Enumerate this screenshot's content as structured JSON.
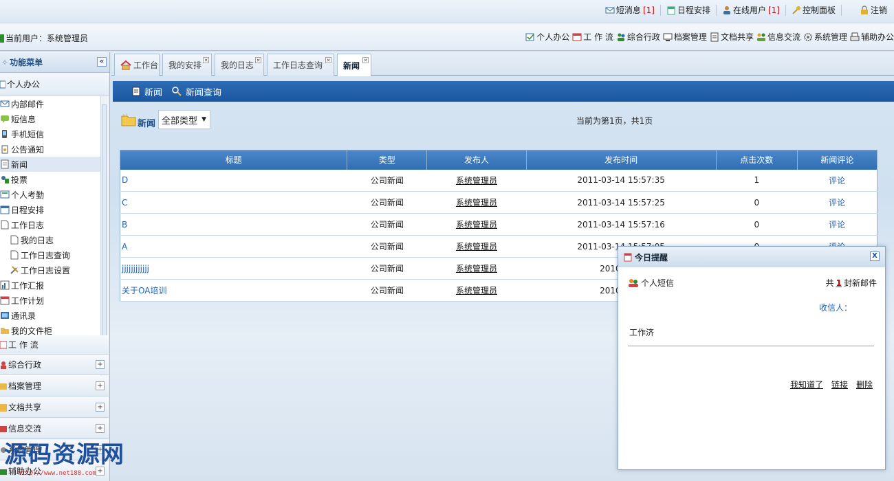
{
  "topbar": {
    "links": [
      {
        "label": "短消息",
        "badge": "[1]",
        "icon": "envelope-icon"
      },
      {
        "label": "日程安排",
        "icon": "calendar-icon"
      },
      {
        "label": "在线用户",
        "badge": "[1]",
        "icon": "user-icon"
      },
      {
        "label": "控制面板",
        "icon": "key-icon"
      },
      {
        "label": "注销",
        "icon": "lock-icon"
      }
    ]
  },
  "userbar": {
    "current_user": "当前用户：系统管理员",
    "modules": [
      "个人办公",
      "工 作 流",
      "综合行政",
      "档案管理",
      "文档共享",
      "信息交流",
      "系统管理",
      "辅助办公"
    ]
  },
  "sidebar": {
    "title": "功能菜单",
    "collapse": "«",
    "open_group": "个人办公",
    "items": [
      {
        "label": "内部邮件",
        "sub": false
      },
      {
        "label": "短信息",
        "sub": false
      },
      {
        "label": "手机短信",
        "sub": false
      },
      {
        "label": "公告通知",
        "sub": false
      },
      {
        "label": "新闻",
        "sub": false,
        "active": true
      },
      {
        "label": "投票",
        "sub": false
      },
      {
        "label": "个人考勤",
        "sub": false
      },
      {
        "label": "日程安排",
        "sub": false
      },
      {
        "label": "工作日志",
        "sub": false
      },
      {
        "label": "我的日志",
        "sub": true
      },
      {
        "label": "工作日志查询",
        "sub": true
      },
      {
        "label": "工作日志设置",
        "sub": true
      },
      {
        "label": "工作汇报",
        "sub": false
      },
      {
        "label": "工作计划",
        "sub": false
      },
      {
        "label": "通讯录",
        "sub": false
      },
      {
        "label": "我的文件柜",
        "sub": false
      }
    ],
    "groups": [
      "工 作 流",
      "综合行政",
      "档案管理",
      "文档共享",
      "信息交流",
      "系统管理",
      "辅助办公"
    ],
    "plus": "+"
  },
  "tabs": [
    {
      "label": "工作台",
      "closable": false
    },
    {
      "label": "我的安排",
      "closable": true
    },
    {
      "label": "我的日志",
      "closable": true
    },
    {
      "label": "工作日志查询",
      "closable": true
    },
    {
      "label": "新闻",
      "closable": true,
      "active": true
    }
  ],
  "toolbar": {
    "news_label": "新闻",
    "query_label": "新闻查询"
  },
  "filter": {
    "title": "新闻",
    "select_value": "全部类型",
    "page_info": "当前为第1页，共1页"
  },
  "table": {
    "headers": [
      "标题",
      "类型",
      "发布人",
      "发布时间",
      "点击次数",
      "新闻评论"
    ],
    "rows": [
      {
        "title": "D",
        "type": "公司新闻",
        "publisher": "系统管理员",
        "time": "2011-03-14 15:57:35",
        "clicks": "1",
        "comment": "评论"
      },
      {
        "title": "C",
        "type": "公司新闻",
        "publisher": "系统管理员",
        "time": "2011-03-14 15:57:25",
        "clicks": "0",
        "comment": "评论"
      },
      {
        "title": "B",
        "type": "公司新闻",
        "publisher": "系统管理员",
        "time": "2011-03-14 15:57:16",
        "clicks": "0",
        "comment": "评论"
      },
      {
        "title": "A",
        "type": "公司新闻",
        "publisher": "系统管理员",
        "time": "2011-03-14 15:57:05",
        "clicks": "0",
        "comment": "评论"
      },
      {
        "title": "jjjjjjjjjjjj",
        "type": "公司新闻",
        "publisher": "系统管理员",
        "time": "2010-02-0",
        "clicks": "",
        "comment": ""
      },
      {
        "title": "关于OA培训",
        "type": "公司新闻",
        "publisher": "系统管理员",
        "time": "2010-02-0",
        "clicks": "",
        "comment": ""
      }
    ]
  },
  "popup": {
    "title": "今日提醒",
    "close": "X",
    "category": "个人短信",
    "count_prefix": "共",
    "count": "1",
    "count_suffix": "封新邮件",
    "receiver_label": "收信人：",
    "message": "工作济",
    "actions": [
      "我知道了",
      "链接",
      "删除"
    ]
  },
  "watermark": {
    "text": "源码资源网",
    "url": "http://www.net188.com"
  }
}
